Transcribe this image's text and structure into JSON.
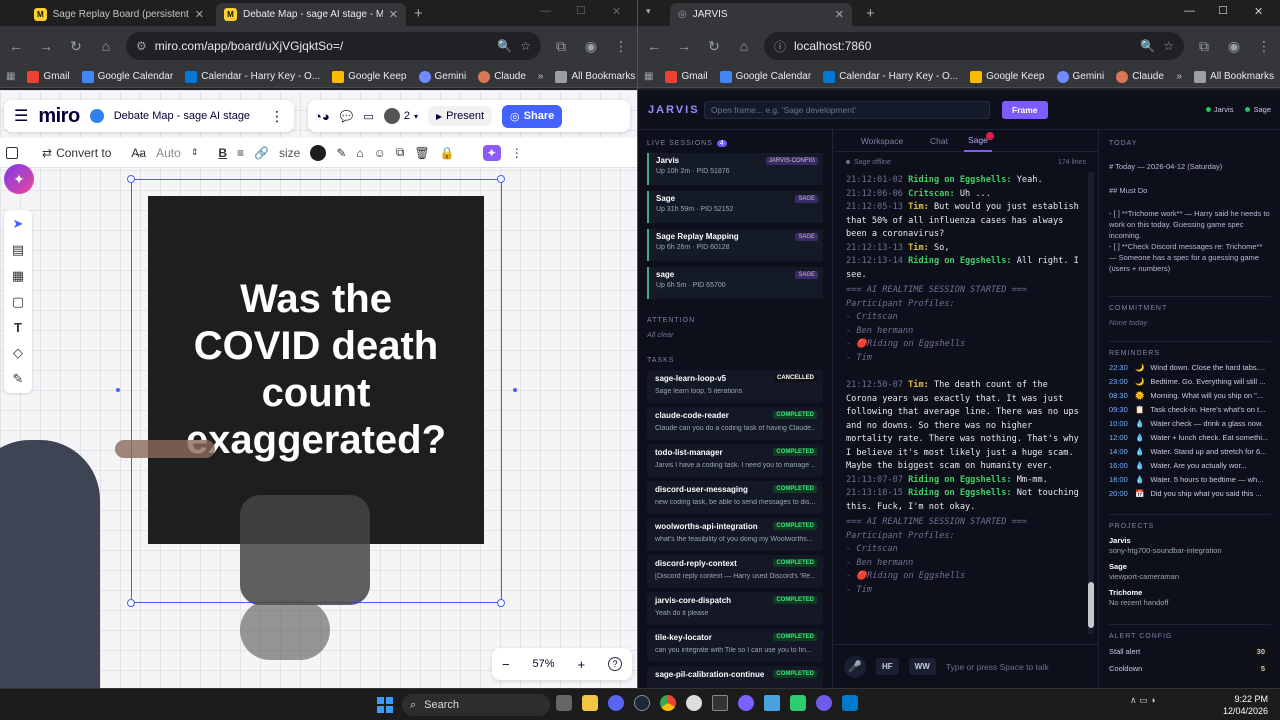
{
  "left_browser": {
    "tabs": [
      {
        "title": "Sage Replay Board (persistent) - Miro",
        "active": false
      },
      {
        "title": "Debate Map - sage AI stage - Miro",
        "active": true
      }
    ],
    "url": "miro.com/app/board/uXjVGjqktSo=/",
    "bookmarks": [
      "Gmail",
      "Google Calendar",
      "Calendar - Harry Key - O...",
      "Google Keep",
      "Gemini",
      "Claude"
    ],
    "all_bookmarks": "All Bookmarks"
  },
  "right_browser": {
    "tabs": [
      {
        "title": "JARVIS",
        "active": true
      }
    ],
    "url": "localhost:7860",
    "bookmarks": [
      "Gmail",
      "Google Calendar",
      "Calendar - Harry Key - O...",
      "Google Keep",
      "Gemini",
      "Claude"
    ],
    "all_bookmarks": "All Bookmarks"
  },
  "miro": {
    "logo": "miro",
    "board_name": "Debate Map - sage AI stage",
    "collaborators": "2",
    "present": "Present",
    "share": "Share",
    "convert_to": "Convert to",
    "font_size": "Auto",
    "size_label": "size",
    "card_text": [
      "Was the",
      "COVID death",
      "count",
      "exaggerated?"
    ],
    "zoom": "57%",
    "zoom_level_fraction": 0.57
  },
  "jarvis": {
    "brand": "JARVIS",
    "frame_placeholder": "Open frame... e.g. 'Sage development'",
    "frame_button": "Frame",
    "status_dots": [
      {
        "label": "Jarvis",
        "color": "#22c55e"
      },
      {
        "label": "Sage",
        "color": "#22c55e"
      }
    ],
    "live_sessions_label": "LIVE SESSIONS",
    "live_sessions_count": "4",
    "sessions": [
      {
        "name": "Jarvis",
        "sub": "Up 10h 2m · PID 51876",
        "badge": "JARVIS-CONFIG"
      },
      {
        "name": "Sage",
        "sub": "Up 31h 59m · PID 52152",
        "badge": "SAGE"
      },
      {
        "name": "Sage Replay Mapping",
        "sub": "Up 6h 26m · PID 60128",
        "badge": "SAGE"
      },
      {
        "name": "sage",
        "sub": "Up 6h 5m · PID 65700",
        "badge": "SAGE"
      }
    ],
    "attention_label": "ATTENTION",
    "attention_value": "All clear",
    "tasks_label": "TASKS",
    "tasks": [
      {
        "name": "sage-learn-loop-v5",
        "sub": "Sage learn loop, 5 iterations",
        "badge": "CANCELLED"
      },
      {
        "name": "claude-code-reader",
        "sub": "Claude can you do a coding task of having Claude...",
        "badge": "COMPLETED"
      },
      {
        "name": "todo-list-manager",
        "sub": "Jarvis I have a coding task. I need you to manage ...",
        "badge": "COMPLETED"
      },
      {
        "name": "discord-user-messaging",
        "sub": "new coding task, be able to send messages to dis...",
        "badge": "COMPLETED"
      },
      {
        "name": "woolworths-api-integration",
        "sub": "what's the feasibility of you doing my Woolworths...",
        "badge": "COMPLETED"
      },
      {
        "name": "discord-reply-context",
        "sub": "[Discord reply context — Harry used Discord's 'Re...",
        "badge": "COMPLETED"
      },
      {
        "name": "jarvis-core-dispatch",
        "sub": "Yeah do it please",
        "badge": "COMPLETED"
      },
      {
        "name": "tile-key-locator",
        "sub": "can you integrate with Tile so I can use you to fin...",
        "badge": "COMPLETED"
      },
      {
        "name": "sage-pil-calibration-continue",
        "sub": "",
        "badge": "COMPLETED"
      }
    ],
    "center_tabs": [
      "Workspace",
      "Chat",
      "Sage"
    ],
    "active_center_tab": "Sage",
    "sage_status": "Sage offline",
    "lines_count": "174 lines",
    "transcript": [
      {
        "ts": "21:12:01-02",
        "speaker": "Riding on Eggshells:",
        "who": "sp2",
        "text": "Yeah."
      },
      {
        "ts": "21:12:06-06",
        "speaker": "Critscan:",
        "who": "sp2",
        "text": "Uh ..."
      },
      {
        "ts": "21:12:05-13",
        "speaker": "Tim:",
        "who": "sp1",
        "text": "But would you just establish that 50% of all influenza cases has always been a coronavirus?"
      },
      {
        "ts": "21:12:13-13",
        "speaker": "Tim:",
        "who": "sp1",
        "text": "So,"
      },
      {
        "ts": "21:12:13-14",
        "speaker": "Riding on Eggshells:",
        "who": "sp2",
        "text": "All right. I see."
      },
      {
        "sys": "=== AI REALTIME SESSION STARTED ==="
      },
      {
        "sys": "Participant Profiles:"
      },
      {
        "sys": "- Critscan"
      },
      {
        "sys": "- Ben hermann"
      },
      {
        "sys": "- 🔴Riding on Eggshells"
      },
      {
        "sys": "- Tim"
      },
      {
        "ts": "21:12:50-07",
        "speaker": "Tim:",
        "who": "sp1",
        "text": "The death count of the Corona years was exactly that. It was just following that average line. There was no ups and no downs. So there was no higher mortality rate. There was nothing. That's why I believe it's most likely just a huge scam. Maybe the biggest scam on humanity ever."
      },
      {
        "ts": "21:13:07-07",
        "speaker": "Riding on Eggshells:",
        "who": "sp2",
        "text": "Mm-mm."
      },
      {
        "ts": "21:13:10-15",
        "speaker": "Riding on Eggshells:",
        "who": "sp2",
        "text": "Not touching this. Fuck, I'm not okay."
      },
      {
        "sys": "=== AI REALTIME SESSION STARTED ==="
      },
      {
        "sys": "Participant Profiles:"
      },
      {
        "sys": "- Critscan"
      },
      {
        "sys": "- Ben hermann"
      },
      {
        "sys": "- 🔴Riding on Eggshells"
      },
      {
        "sys": "- Tim"
      }
    ],
    "input_buttons": [
      "HF",
      "WW"
    ],
    "input_placeholder": "Type or press Space to talk",
    "today_label": "TODAY",
    "today_title": "# Today — 2026-04-12 (Saturday)",
    "must_do": "## Must Do",
    "todo_1": "- [ ] **Trichome work** — Harry said he needs to work on this today. Guessing game spec incoming.",
    "todo_2": "- [ ] **Check Discord messages re: Trichome** — Someone has a spec for a guessing game (users + numbers)",
    "commitment_label": "COMMITMENT",
    "commitment_value": "None today",
    "reminders_label": "REMINDERS",
    "reminders": [
      {
        "time": "22:30",
        "icon": "🌙",
        "text": "Wind down. Close the hard tabs...."
      },
      {
        "time": "23:00",
        "icon": "🌙",
        "text": "Bedtime. Go. Everything will still ..."
      },
      {
        "time": "08:30",
        "icon": "🌞",
        "text": "Morning. What will you ship on \"..."
      },
      {
        "time": "09:30",
        "icon": "📋",
        "text": "Task check-in. Here's what's on t..."
      },
      {
        "time": "10:00",
        "icon": "💧",
        "text": "Water check — drink a glass now."
      },
      {
        "time": "12:00",
        "icon": "💧",
        "text": "Water + lunch check. Eat somethi..."
      },
      {
        "time": "14:00",
        "icon": "💧",
        "text": "Water. Stand up and stretch for 6..."
      },
      {
        "time": "16:00",
        "icon": "💧",
        "text": "Water. Are you actually wor..."
      },
      {
        "time": "18:00",
        "icon": "💧",
        "text": "Water. 5 hours to bedtime — wh..."
      },
      {
        "time": "20:00",
        "icon": "📅",
        "text": "Did you ship what you said this ..."
      }
    ],
    "projects_label": "PROJECTS",
    "projects": [
      {
        "name": "Jarvis",
        "sub": "sony-htg700-soundbar-integration"
      },
      {
        "name": "Sage",
        "sub": "viewport-cameraman"
      },
      {
        "name": "Trichome",
        "sub": "No recent handoff"
      }
    ],
    "alert_label": "ALERT CONFIG",
    "alerts": [
      {
        "name": "Stall alert",
        "value": "30"
      },
      {
        "name": "Cooldown",
        "value": "5"
      }
    ]
  },
  "taskbar": {
    "search": "Search",
    "time": "9:22 PM",
    "date": "12/04/2026"
  }
}
